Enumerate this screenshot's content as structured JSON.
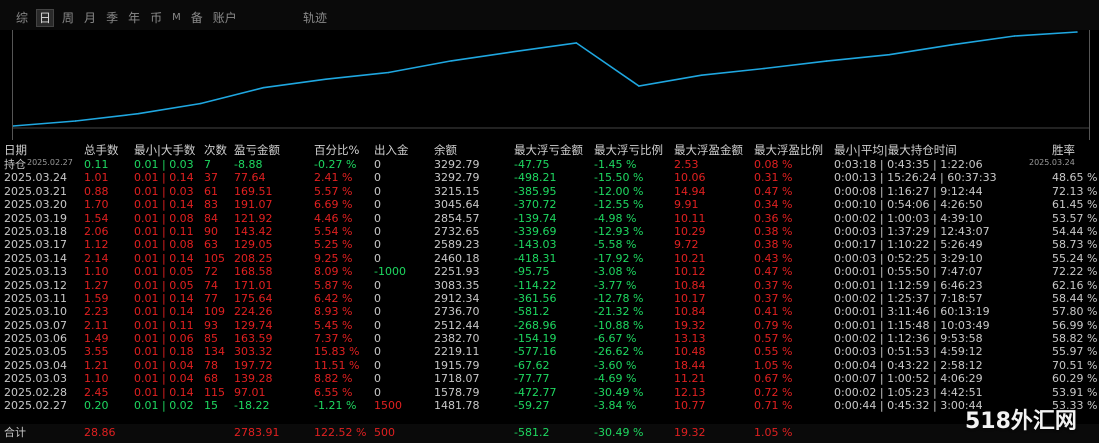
{
  "tabs": [
    {
      "label": "综",
      "active": false,
      "small": false
    },
    {
      "label": "日",
      "active": true,
      "small": false
    },
    {
      "label": "周",
      "active": false,
      "small": false
    },
    {
      "label": "月",
      "active": false,
      "small": false
    },
    {
      "label": "季",
      "active": false,
      "small": false
    },
    {
      "label": "年",
      "active": false,
      "small": false
    },
    {
      "label": "币",
      "active": false,
      "small": false
    },
    {
      "label": "M",
      "active": false,
      "small": true
    },
    {
      "label": "备",
      "active": false,
      "small": false
    },
    {
      "label": "账户",
      "active": false,
      "small": false
    }
  ],
  "track_label": "轨迹",
  "chart_data": {
    "type": "line",
    "x": [
      "2025.02.27",
      "2025.02.28",
      "2025.03.03",
      "2025.03.04",
      "2025.03.05",
      "2025.03.06",
      "2025.03.07",
      "2025.03.10",
      "2025.03.11",
      "2025.03.12",
      "2025.03.13",
      "2025.03.14",
      "2025.03.17",
      "2025.03.18",
      "2025.03.19",
      "2025.03.20",
      "2025.03.21",
      "2025.03.24"
    ],
    "series": [
      {
        "values": [
          1481.78,
          1578.79,
          1718.07,
          1915.79,
          2219.11,
          2382.7,
          2512.44,
          2736.7,
          2912.34,
          3083.35,
          2251.93,
          2460.18,
          2589.23,
          2732.65,
          2854.57,
          3045.64,
          3215.15,
          3292.79
        ]
      }
    ],
    "x_tick_labels": [
      "2025.02.27",
      "2025.03.24"
    ],
    "line_color": "#1fa7e0"
  },
  "headers": [
    "日期",
    "总手数",
    "最小|大手数",
    "次数",
    "盈亏金额",
    "百分比%",
    "出入金",
    "余额",
    "最大浮亏金额",
    "最大浮亏比例",
    "最大浮盈金额",
    "最大浮盈比例",
    "最小|平均|最大持仓时间",
    "胜率"
  ],
  "holding": {
    "date": "持仓",
    "lots": "0.11",
    "minmax": "0.01 | 0.03",
    "count": "7",
    "pnl": "-8.88",
    "pct": "-0.27 %",
    "io": "0",
    "balance": "3292.79",
    "max_dd": "-47.75",
    "max_dd_pct": "-1.45 %",
    "max_fp": "2.53",
    "max_fp_pct": "0.08 %",
    "hold": "0:03:18 | 0:43:35 | 1:22:06",
    "win": ""
  },
  "rows": [
    {
      "date": "2025.03.24",
      "lots": "1.01",
      "minmax": "0.01 | 0.14",
      "count": "37",
      "pnl": "77.64",
      "pct": "2.41 %",
      "io": "0",
      "balance": "3292.79",
      "max_dd": "-498.21",
      "max_dd_pct": "-15.50 %",
      "max_fp": "10.06",
      "max_fp_pct": "0.31 %",
      "hold": "0:00:13 | 15:26:24 | 60:37:33",
      "win": "48.65 %"
    },
    {
      "date": "2025.03.21",
      "lots": "0.88",
      "minmax": "0.01 | 0.03",
      "count": "61",
      "pnl": "169.51",
      "pct": "5.57 %",
      "io": "0",
      "balance": "3215.15",
      "max_dd": "-385.95",
      "max_dd_pct": "-12.00 %",
      "max_fp": "14.94",
      "max_fp_pct": "0.47 %",
      "hold": "0:00:08 | 1:16:27 | 9:12:44",
      "win": "72.13 %"
    },
    {
      "date": "2025.03.20",
      "lots": "1.70",
      "minmax": "0.01 | 0.14",
      "count": "83",
      "pnl": "191.07",
      "pct": "6.69 %",
      "io": "0",
      "balance": "3045.64",
      "max_dd": "-370.72",
      "max_dd_pct": "-12.55 %",
      "max_fp": "9.91",
      "max_fp_pct": "0.34 %",
      "hold": "0:00:10 | 0:54:06 | 4:26:50",
      "win": "61.45 %"
    },
    {
      "date": "2025.03.19",
      "lots": "1.54",
      "minmax": "0.01 | 0.08",
      "count": "84",
      "pnl": "121.92",
      "pct": "4.46 %",
      "io": "0",
      "balance": "2854.57",
      "max_dd": "-139.74",
      "max_dd_pct": "-4.98 %",
      "max_fp": "10.11",
      "max_fp_pct": "0.36 %",
      "hold": "0:00:02 | 1:00:03 | 4:39:10",
      "win": "53.57 %"
    },
    {
      "date": "2025.03.18",
      "lots": "2.06",
      "minmax": "0.01 | 0.11",
      "count": "90",
      "pnl": "143.42",
      "pct": "5.54 %",
      "io": "0",
      "balance": "2732.65",
      "max_dd": "-339.69",
      "max_dd_pct": "-12.93 %",
      "max_fp": "10.29",
      "max_fp_pct": "0.38 %",
      "hold": "0:00:03 | 1:37:29 | 12:43:07",
      "win": "54.44 %"
    },
    {
      "date": "2025.03.17",
      "lots": "1.12",
      "minmax": "0.01 | 0.08",
      "count": "63",
      "pnl": "129.05",
      "pct": "5.25 %",
      "io": "0",
      "balance": "2589.23",
      "max_dd": "-143.03",
      "max_dd_pct": "-5.58 %",
      "max_fp": "9.72",
      "max_fp_pct": "0.38 %",
      "hold": "0:00:17 | 1:10:22 | 5:26:49",
      "win": "58.73 %"
    },
    {
      "date": "2025.03.14",
      "lots": "2.14",
      "minmax": "0.01 | 0.14",
      "count": "105",
      "pnl": "208.25",
      "pct": "9.25 %",
      "io": "0",
      "balance": "2460.18",
      "max_dd": "-418.31",
      "max_dd_pct": "-17.92 %",
      "max_fp": "10.21",
      "max_fp_pct": "0.43 %",
      "hold": "0:00:03 | 0:52:25 | 3:29:10",
      "win": "55.24 %"
    },
    {
      "date": "2025.03.13",
      "lots": "1.10",
      "minmax": "0.01 | 0.05",
      "count": "72",
      "pnl": "168.58",
      "pct": "8.09 %",
      "io": "-1000",
      "balance": "2251.93",
      "max_dd": "-95.75",
      "max_dd_pct": "-3.08 %",
      "max_fp": "10.12",
      "max_fp_pct": "0.47 %",
      "hold": "0:00:01 | 0:55:50 | 7:47:07",
      "win": "72.22 %"
    },
    {
      "date": "2025.03.12",
      "lots": "1.27",
      "minmax": "0.01 | 0.05",
      "count": "74",
      "pnl": "171.01",
      "pct": "5.87 %",
      "io": "0",
      "balance": "3083.35",
      "max_dd": "-114.22",
      "max_dd_pct": "-3.77 %",
      "max_fp": "10.84",
      "max_fp_pct": "0.37 %",
      "hold": "0:00:01 | 1:12:59 | 6:46:23",
      "win": "62.16 %"
    },
    {
      "date": "2025.03.11",
      "lots": "1.59",
      "minmax": "0.01 | 0.14",
      "count": "77",
      "pnl": "175.64",
      "pct": "6.42 %",
      "io": "0",
      "balance": "2912.34",
      "max_dd": "-361.56",
      "max_dd_pct": "-12.78 %",
      "max_fp": "10.17",
      "max_fp_pct": "0.37 %",
      "hold": "0:00:02 | 1:25:37 | 7:18:57",
      "win": "58.44 %"
    },
    {
      "date": "2025.03.10",
      "lots": "2.23",
      "minmax": "0.01 | 0.14",
      "count": "109",
      "pnl": "224.26",
      "pct": "8.93 %",
      "io": "0",
      "balance": "2736.70",
      "max_dd": "-581.2",
      "max_dd_pct": "-21.32 %",
      "max_fp": "10.84",
      "max_fp_pct": "0.41 %",
      "hold": "0:00:01 | 3:11:46 | 60:13:19",
      "win": "57.80 %"
    },
    {
      "date": "2025.03.07",
      "lots": "2.11",
      "minmax": "0.01 | 0.11",
      "count": "93",
      "pnl": "129.74",
      "pct": "5.45 %",
      "io": "0",
      "balance": "2512.44",
      "max_dd": "-268.96",
      "max_dd_pct": "-10.88 %",
      "max_fp": "19.32",
      "max_fp_pct": "0.79 %",
      "hold": "0:00:01 | 1:15:48 | 10:03:49",
      "win": "56.99 %"
    },
    {
      "date": "2025.03.06",
      "lots": "1.49",
      "minmax": "0.01 | 0.06",
      "count": "85",
      "pnl": "163.59",
      "pct": "7.37 %",
      "io": "0",
      "balance": "2382.70",
      "max_dd": "-154.19",
      "max_dd_pct": "-6.67 %",
      "max_fp": "13.13",
      "max_fp_pct": "0.57 %",
      "hold": "0:00:02 | 1:12:36 | 9:53:58",
      "win": "58.82 %"
    },
    {
      "date": "2025.03.05",
      "lots": "3.55",
      "minmax": "0.01 | 0.18",
      "count": "134",
      "pnl": "303.32",
      "pct": "15.83 %",
      "io": "0",
      "balance": "2219.11",
      "max_dd": "-577.16",
      "max_dd_pct": "-26.62 %",
      "max_fp": "10.48",
      "max_fp_pct": "0.55 %",
      "hold": "0:00:03 | 0:51:53 | 4:59:12",
      "win": "55.97 %"
    },
    {
      "date": "2025.03.04",
      "lots": "1.21",
      "minmax": "0.01 | 0.04",
      "count": "78",
      "pnl": "197.72",
      "pct": "11.51 %",
      "io": "0",
      "balance": "1915.79",
      "max_dd": "-67.62",
      "max_dd_pct": "-3.60 %",
      "max_fp": "18.44",
      "max_fp_pct": "1.05 %",
      "hold": "0:00:04 | 0:43:22 | 2:58:12",
      "win": "70.51 %"
    },
    {
      "date": "2025.03.03",
      "lots": "1.10",
      "minmax": "0.01 | 0.04",
      "count": "68",
      "pnl": "139.28",
      "pct": "8.82 %",
      "io": "0",
      "balance": "1718.07",
      "max_dd": "-77.77",
      "max_dd_pct": "-4.69 %",
      "max_fp": "11.21",
      "max_fp_pct": "0.67 %",
      "hold": "0:00:07 | 1:00:52 | 4:06:29",
      "win": "60.29 %"
    },
    {
      "date": "2025.02.28",
      "lots": "2.45",
      "minmax": "0.01 | 0.14",
      "count": "115",
      "pnl": "97.01",
      "pct": "6.55 %",
      "io": "0",
      "balance": "1578.79",
      "max_dd": "-472.77",
      "max_dd_pct": "-30.49 %",
      "max_fp": "12.13",
      "max_fp_pct": "0.72 %",
      "hold": "0:00:02 | 1:05:23 | 4:42:51",
      "win": "53.91 %"
    },
    {
      "date": "2025.02.27",
      "lots": "0.20",
      "minmax": "0.01 | 0.02",
      "count": "15",
      "pnl": "-18.22",
      "pct": "-1.21 %",
      "io": "1500",
      "balance": "1481.78",
      "max_dd": "-59.27",
      "max_dd_pct": "-3.84 %",
      "max_fp": "10.77",
      "max_fp_pct": "0.71 %",
      "hold": "0:00:44 | 0:45:32 | 3:00:44",
      "win": "53.33 %"
    }
  ],
  "total": {
    "date": "合计",
    "lots": "28.86",
    "minmax": "",
    "count": "",
    "pnl": "2783.91",
    "pct": "122.52 %",
    "io": "500",
    "balance": "",
    "max_dd": "-581.2",
    "max_dd_pct": "-30.49 %",
    "max_fp": "19.32",
    "max_fp_pct": "1.05 %",
    "hold": "",
    "win": ""
  },
  "watermark": "518外汇网",
  "colors": {
    "positive": "#1ed760",
    "negative": "#e02020",
    "neutral": "#c8c8c8",
    "line": "#1fa7e0"
  }
}
